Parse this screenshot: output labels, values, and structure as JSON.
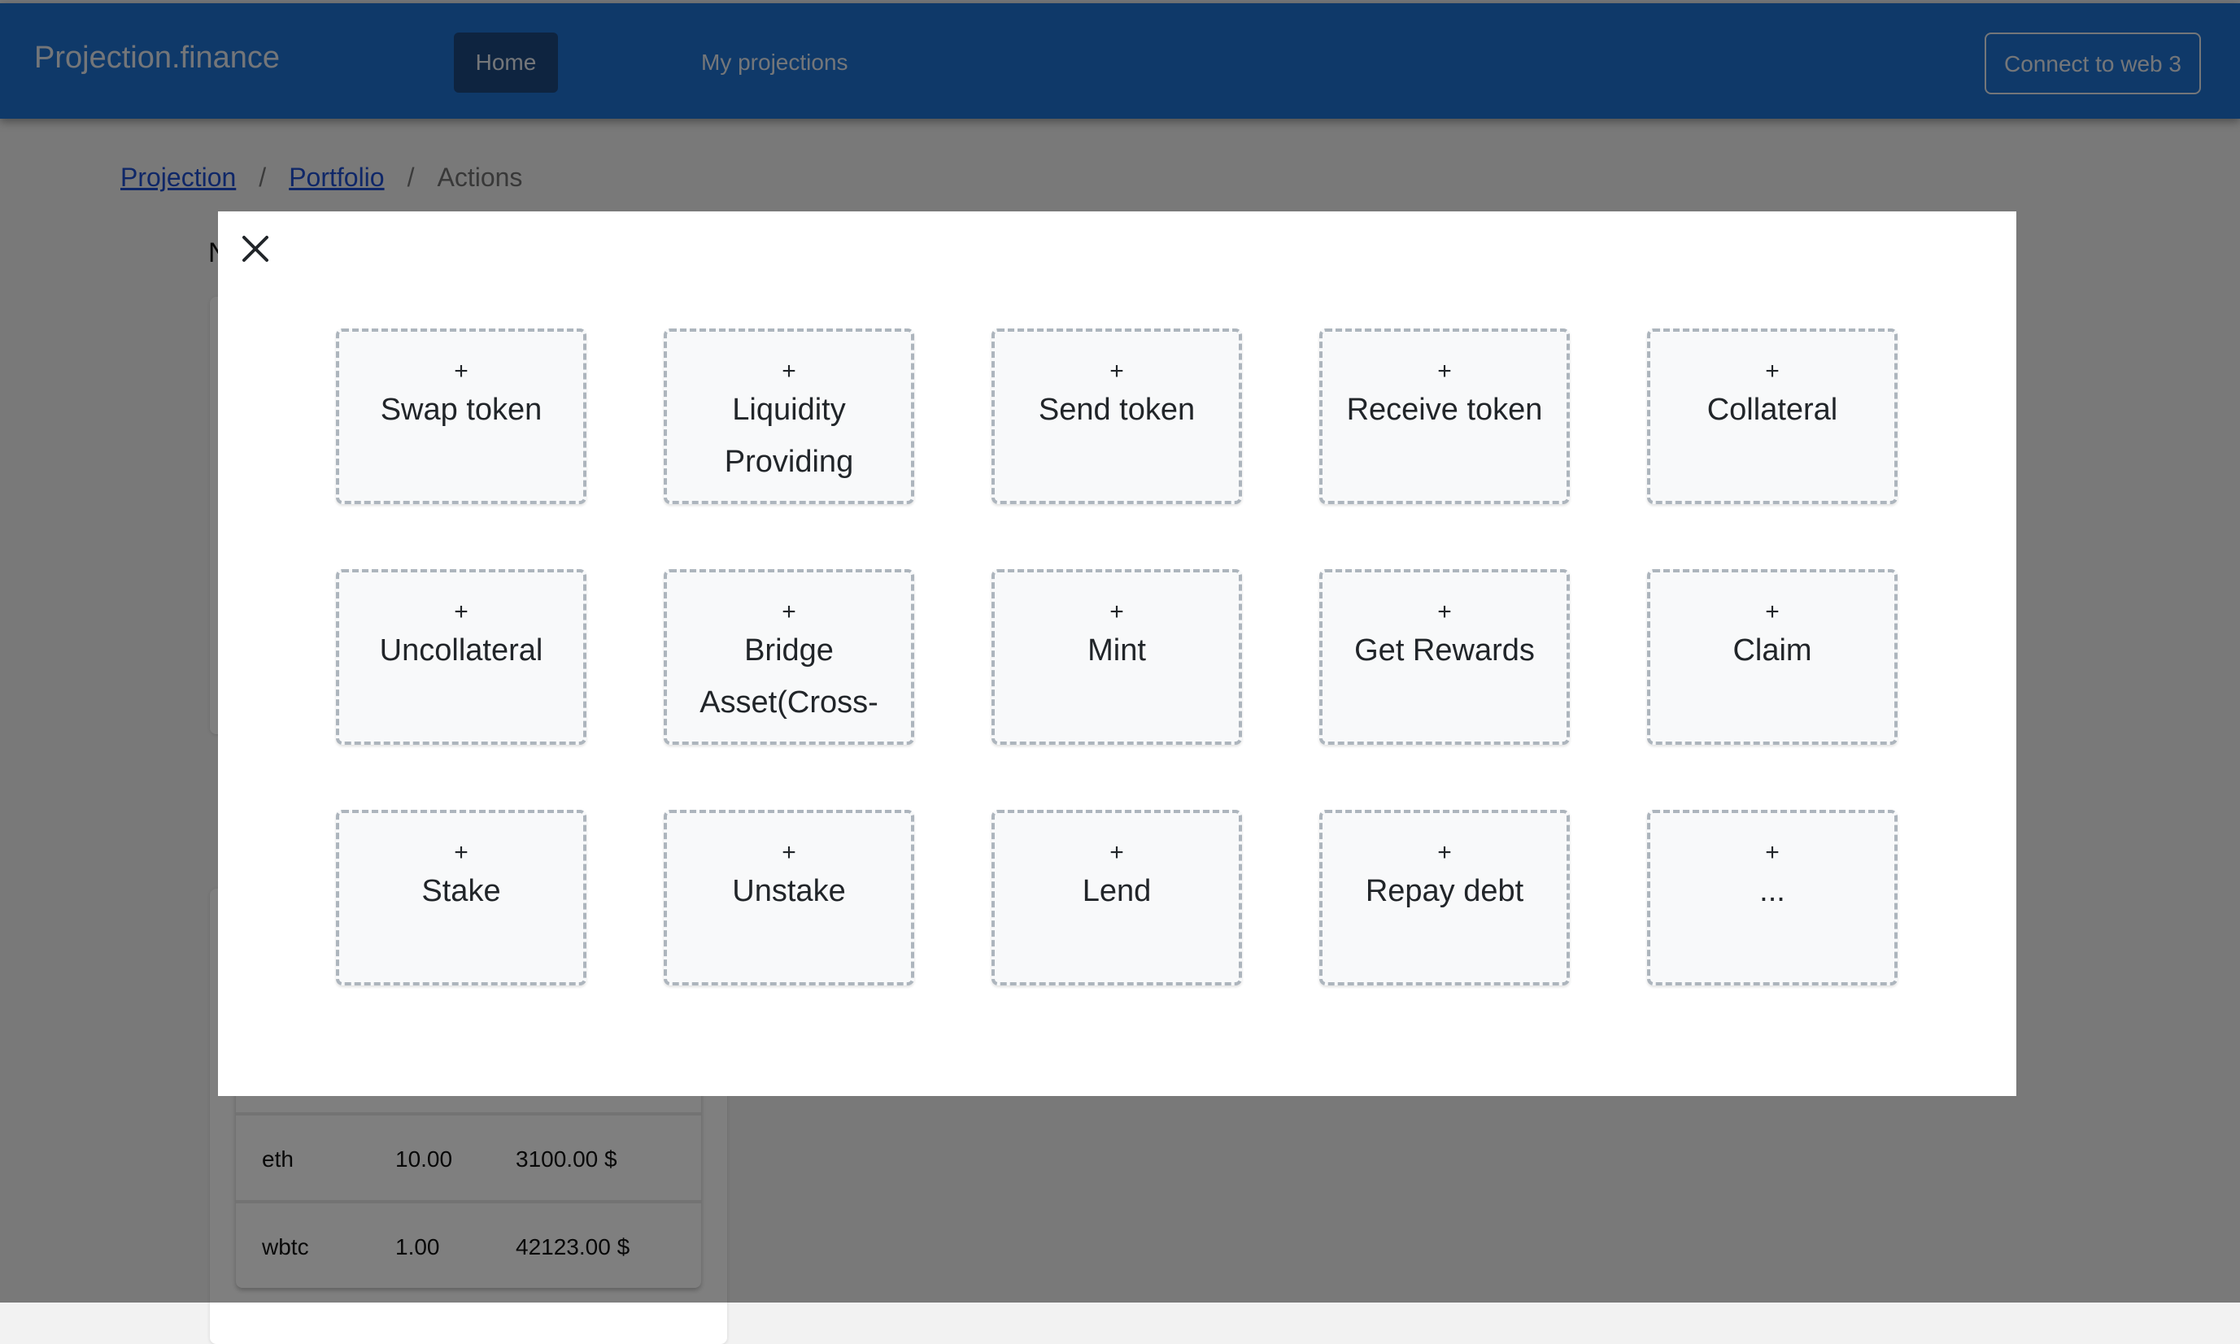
{
  "navbar": {
    "brand": "Projection.finance",
    "items": [
      {
        "label": "Home",
        "active": true
      },
      {
        "label": "My projections",
        "active": false
      }
    ],
    "connect_button": "Connect to web 3"
  },
  "breadcrumb": {
    "items": [
      {
        "label": "Projection",
        "link": true
      },
      {
        "label": "Portfolio",
        "link": true
      },
      {
        "label": "Actions",
        "link": false
      }
    ],
    "separator": "/"
  },
  "background": {
    "heading_fragment": "N",
    "holdings": [
      {
        "token": "eth",
        "amount": "10.00",
        "value": "3100.00 $"
      },
      {
        "token": "wbtc",
        "amount": "1.00",
        "value": "42123.00 $"
      }
    ]
  },
  "modal": {
    "close_icon": "close-icon",
    "plus_symbol": "+",
    "actions": [
      {
        "label": "Swap token"
      },
      {
        "label": "Liquidity Providing"
      },
      {
        "label": "Send token"
      },
      {
        "label": "Receive token"
      },
      {
        "label": "Collateral"
      },
      {
        "label": "Uncollateral"
      },
      {
        "label": "Bridge Asset(Cross-chain)"
      },
      {
        "label": "Mint"
      },
      {
        "label": "Get Rewards"
      },
      {
        "label": "Claim"
      },
      {
        "label": "Stake"
      },
      {
        "label": "Unstake"
      },
      {
        "label": "Lend"
      },
      {
        "label": "Repay debt"
      },
      {
        "label": "..."
      }
    ]
  },
  "colors": {
    "navbar": "#1f72d2",
    "card_border": "#adb5bd",
    "card_bg": "#f8f9fa",
    "link": "#1f4fd0"
  }
}
